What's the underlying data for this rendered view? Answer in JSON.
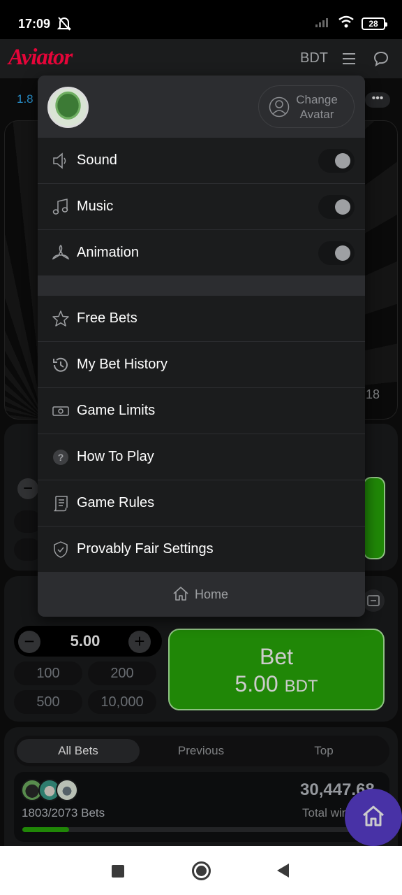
{
  "status_bar": {
    "time": "17:09",
    "battery": "28"
  },
  "header": {
    "logo": "Aviator",
    "currency": "BDT"
  },
  "background": {
    "ticker_first": "1.8",
    "side_number": "18"
  },
  "menu": {
    "change_avatar_label": "Change Avatar",
    "settings": [
      {
        "label": "Sound",
        "icon": "speaker-icon",
        "enabled": false
      },
      {
        "label": "Music",
        "icon": "music-note-icon",
        "enabled": false
      },
      {
        "label": "Animation",
        "icon": "propeller-icon",
        "enabled": false
      }
    ],
    "items": [
      {
        "label": "Free Bets",
        "icon": "star-icon"
      },
      {
        "label": "My Bet History",
        "icon": "history-icon"
      },
      {
        "label": "Game Limits",
        "icon": "banknote-icon"
      },
      {
        "label": "How To Play",
        "icon": "question-icon"
      },
      {
        "label": "Game Rules",
        "icon": "scroll-icon"
      },
      {
        "label": "Provably Fair Settings",
        "icon": "shield-check-icon"
      }
    ],
    "home_label": "Home"
  },
  "bet_panel": {
    "amount": "5.00",
    "quick_amounts": [
      "100",
      "200",
      "500",
      "10,000"
    ],
    "bet_button_title": "Bet",
    "bet_button_amount": "5.00",
    "bet_button_currency": "BDT"
  },
  "bets_list": {
    "tabs": [
      "All Bets",
      "Previous",
      "Top"
    ],
    "active_tab": "All Bets",
    "bets_count": "1803/2073",
    "bets_label": "Bets",
    "total_win": "30,447.68",
    "total_win_label": "Total win",
    "progress_fraction": 0.13
  },
  "colors": {
    "brand_red": "#e50539",
    "bet_green": "#28a909",
    "fab_purple": "#5b3fd0",
    "ticker_blue": "#34b4ff"
  }
}
